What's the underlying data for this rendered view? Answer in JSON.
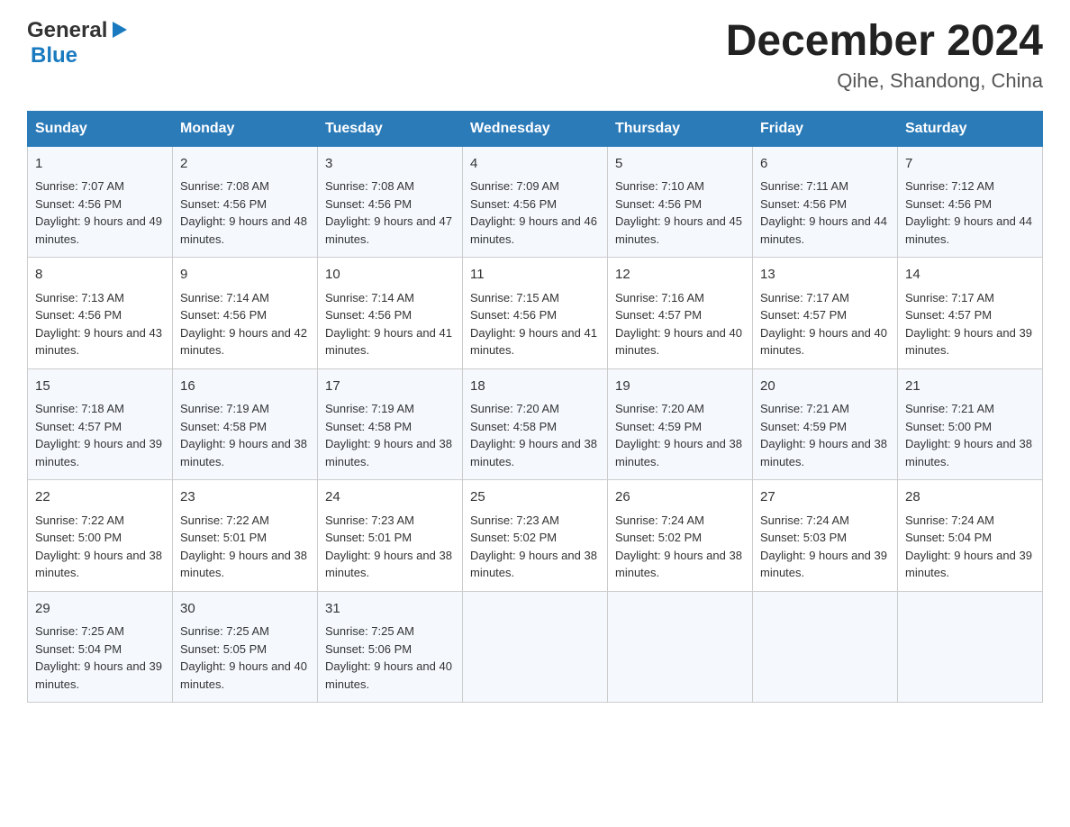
{
  "header": {
    "logo_general": "General",
    "logo_blue": "Blue",
    "month_title": "December 2024",
    "subtitle": "Qihe, Shandong, China"
  },
  "weekdays": [
    "Sunday",
    "Monday",
    "Tuesday",
    "Wednesday",
    "Thursday",
    "Friday",
    "Saturday"
  ],
  "weeks": [
    [
      {
        "day": "1",
        "sunrise": "7:07 AM",
        "sunset": "4:56 PM",
        "daylight": "9 hours and 49 minutes."
      },
      {
        "day": "2",
        "sunrise": "7:08 AM",
        "sunset": "4:56 PM",
        "daylight": "9 hours and 48 minutes."
      },
      {
        "day": "3",
        "sunrise": "7:08 AM",
        "sunset": "4:56 PM",
        "daylight": "9 hours and 47 minutes."
      },
      {
        "day": "4",
        "sunrise": "7:09 AM",
        "sunset": "4:56 PM",
        "daylight": "9 hours and 46 minutes."
      },
      {
        "day": "5",
        "sunrise": "7:10 AM",
        "sunset": "4:56 PM",
        "daylight": "9 hours and 45 minutes."
      },
      {
        "day": "6",
        "sunrise": "7:11 AM",
        "sunset": "4:56 PM",
        "daylight": "9 hours and 44 minutes."
      },
      {
        "day": "7",
        "sunrise": "7:12 AM",
        "sunset": "4:56 PM",
        "daylight": "9 hours and 44 minutes."
      }
    ],
    [
      {
        "day": "8",
        "sunrise": "7:13 AM",
        "sunset": "4:56 PM",
        "daylight": "9 hours and 43 minutes."
      },
      {
        "day": "9",
        "sunrise": "7:14 AM",
        "sunset": "4:56 PM",
        "daylight": "9 hours and 42 minutes."
      },
      {
        "day": "10",
        "sunrise": "7:14 AM",
        "sunset": "4:56 PM",
        "daylight": "9 hours and 41 minutes."
      },
      {
        "day": "11",
        "sunrise": "7:15 AM",
        "sunset": "4:56 PM",
        "daylight": "9 hours and 41 minutes."
      },
      {
        "day": "12",
        "sunrise": "7:16 AM",
        "sunset": "4:57 PM",
        "daylight": "9 hours and 40 minutes."
      },
      {
        "day": "13",
        "sunrise": "7:17 AM",
        "sunset": "4:57 PM",
        "daylight": "9 hours and 40 minutes."
      },
      {
        "day": "14",
        "sunrise": "7:17 AM",
        "sunset": "4:57 PM",
        "daylight": "9 hours and 39 minutes."
      }
    ],
    [
      {
        "day": "15",
        "sunrise": "7:18 AM",
        "sunset": "4:57 PM",
        "daylight": "9 hours and 39 minutes."
      },
      {
        "day": "16",
        "sunrise": "7:19 AM",
        "sunset": "4:58 PM",
        "daylight": "9 hours and 38 minutes."
      },
      {
        "day": "17",
        "sunrise": "7:19 AM",
        "sunset": "4:58 PM",
        "daylight": "9 hours and 38 minutes."
      },
      {
        "day": "18",
        "sunrise": "7:20 AM",
        "sunset": "4:58 PM",
        "daylight": "9 hours and 38 minutes."
      },
      {
        "day": "19",
        "sunrise": "7:20 AM",
        "sunset": "4:59 PM",
        "daylight": "9 hours and 38 minutes."
      },
      {
        "day": "20",
        "sunrise": "7:21 AM",
        "sunset": "4:59 PM",
        "daylight": "9 hours and 38 minutes."
      },
      {
        "day": "21",
        "sunrise": "7:21 AM",
        "sunset": "5:00 PM",
        "daylight": "9 hours and 38 minutes."
      }
    ],
    [
      {
        "day": "22",
        "sunrise": "7:22 AM",
        "sunset": "5:00 PM",
        "daylight": "9 hours and 38 minutes."
      },
      {
        "day": "23",
        "sunrise": "7:22 AM",
        "sunset": "5:01 PM",
        "daylight": "9 hours and 38 minutes."
      },
      {
        "day": "24",
        "sunrise": "7:23 AM",
        "sunset": "5:01 PM",
        "daylight": "9 hours and 38 minutes."
      },
      {
        "day": "25",
        "sunrise": "7:23 AM",
        "sunset": "5:02 PM",
        "daylight": "9 hours and 38 minutes."
      },
      {
        "day": "26",
        "sunrise": "7:24 AM",
        "sunset": "5:02 PM",
        "daylight": "9 hours and 38 minutes."
      },
      {
        "day": "27",
        "sunrise": "7:24 AM",
        "sunset": "5:03 PM",
        "daylight": "9 hours and 39 minutes."
      },
      {
        "day": "28",
        "sunrise": "7:24 AM",
        "sunset": "5:04 PM",
        "daylight": "9 hours and 39 minutes."
      }
    ],
    [
      {
        "day": "29",
        "sunrise": "7:25 AM",
        "sunset": "5:04 PM",
        "daylight": "9 hours and 39 minutes."
      },
      {
        "day": "30",
        "sunrise": "7:25 AM",
        "sunset": "5:05 PM",
        "daylight": "9 hours and 40 minutes."
      },
      {
        "day": "31",
        "sunrise": "7:25 AM",
        "sunset": "5:06 PM",
        "daylight": "9 hours and 40 minutes."
      },
      null,
      null,
      null,
      null
    ]
  ]
}
